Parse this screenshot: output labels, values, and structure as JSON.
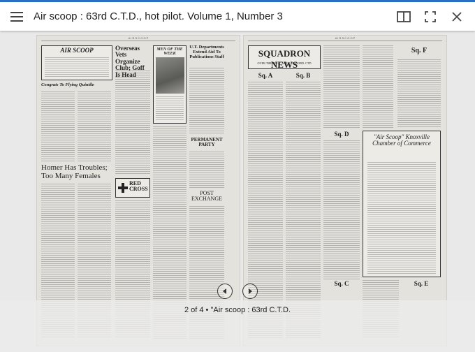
{
  "topbar": {
    "title": "Air scoop : 63rd C.T.D., hot pilot. Volume 1, Number 3",
    "menu_icon": "hamburger-menu-icon",
    "book_icon": "book-view-icon",
    "fullscreen_icon": "fullscreen-icon",
    "close_icon": "close-icon"
  },
  "document": {
    "left_page": {
      "header_center": "A I R   S C O O P",
      "masthead": "AIR SCOOP",
      "headline_1": "Overseas Vets Organize Club; Goff Is Head",
      "headline_2": "MEN OF THE WEEK",
      "headline_3": "U.T. Departments Extend Aid To Publications Staff",
      "headline_4": "Congrats To Flying Quintile",
      "headline_5": "Homer Has Troubles; Too Many Females",
      "headline_6": "PERMANENT PARTY",
      "headline_7": "RED CROSS",
      "headline_8": "POST EXCHANGE"
    },
    "right_page": {
      "header_center": "A I R   S C O O P",
      "banner": "SQUADRON NEWS",
      "subbanner": "OVER THE \"HILL\" WITH THE 63RD. CTD",
      "box_1": "Sq. A",
      "box_2": "Sq. B",
      "box_3": "Sq. F",
      "box_4": "Sq. D",
      "box_5": "Sq. C",
      "box_6": "Sq. E",
      "chamber_title": "\"Air Scoop\" Knoxville Chamber of Commerce"
    }
  },
  "navigation": {
    "prev_icon": "previous-page-icon",
    "next_icon": "next-page-icon",
    "page_status": "2 of 4 • \"Air scoop : 63rd C.T.D."
  }
}
